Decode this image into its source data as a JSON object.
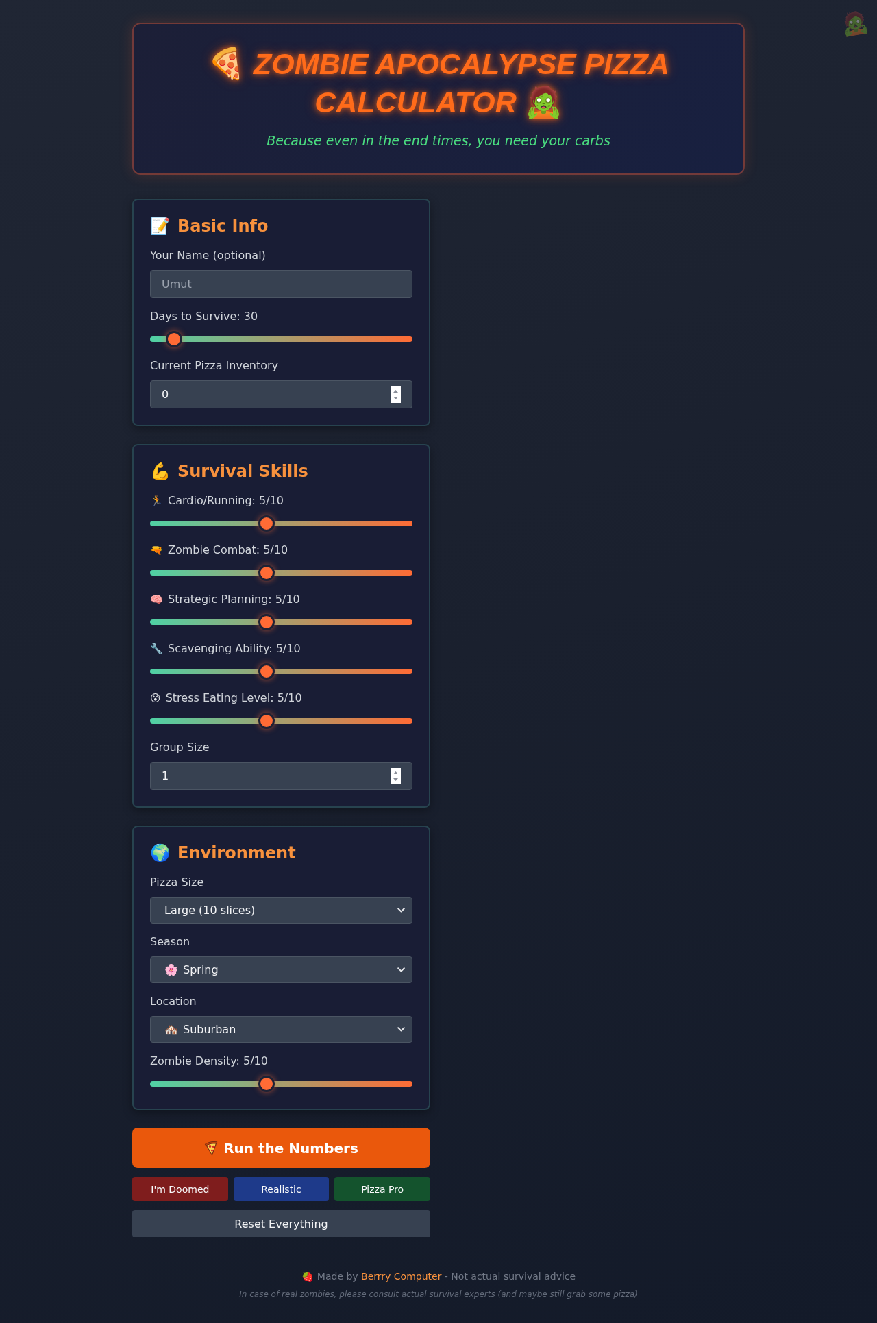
{
  "corner_icon": "🧟",
  "header": {
    "icon_start": "🍕",
    "title_lines": [
      "ZOMBIE APOCALYPSE PIZZA",
      "CALCULATOR"
    ],
    "icon_end": "🧟",
    "subtitle": "Because even in the end times, you need your carbs"
  },
  "sections": [
    {
      "icon": "📝",
      "title": "Basic Info",
      "fields": [
        {
          "kind": "text",
          "label": "Your Name (optional)",
          "placeholder": "Umut"
        },
        {
          "kind": "slider",
          "label": "Days to Survive: 30",
          "level": 0.065
        },
        {
          "kind": "number",
          "label": "Current Pizza Inventory",
          "value": "0"
        }
      ]
    },
    {
      "icon": "💪",
      "title": "Survival Skills",
      "fields": [
        {
          "kind": "slider",
          "icon": "🏃",
          "label": "Cardio/Running: 5/10",
          "level": 0.44
        },
        {
          "kind": "slider",
          "icon": "🔫",
          "label": "Zombie Combat: 5/10",
          "level": 0.44
        },
        {
          "kind": "slider",
          "icon": "🧠",
          "label": "Strategic Planning: 5/10",
          "level": 0.44
        },
        {
          "kind": "slider",
          "icon": "🔧",
          "label": "Scavenging Ability: 5/10",
          "level": 0.44
        },
        {
          "kind": "slider",
          "icon": "😰",
          "label": "Stress Eating Level: 5/10",
          "level": 0.44
        },
        {
          "kind": "number",
          "label": "Group Size",
          "value": "1"
        }
      ]
    },
    {
      "icon": "🌍",
      "title": "Environment",
      "fields": [
        {
          "kind": "select",
          "label": "Pizza Size",
          "value": "Large (10 slices)"
        },
        {
          "kind": "select",
          "label": "Season",
          "icon": "🌸",
          "value": "Spring"
        },
        {
          "kind": "select",
          "label": "Location",
          "icon": "🏘️",
          "value": "Suburban"
        },
        {
          "kind": "slider",
          "label": "Zombie Density: 5/10",
          "level": 0.44
        }
      ]
    }
  ],
  "run_button": {
    "label": "Run the Numbers"
  },
  "presets": [
    {
      "label": "I'm Doomed",
      "color": "#7f1d1d"
    },
    {
      "label": "Realistic",
      "color": "#1e3a8a"
    },
    {
      "label": "Pizza Pro",
      "color": "#14532d"
    }
  ],
  "reset_button": {
    "label": "Reset Everything"
  },
  "footer": {
    "icon": "🍓",
    "credit_prefix": "Made by",
    "credit_link": "Berrry Computer",
    "credit_suffix": "- Not actual survival advice",
    "disclaimer": "In case of real zombies, please consult actual survival experts (and maybe still grab some pizza)"
  }
}
